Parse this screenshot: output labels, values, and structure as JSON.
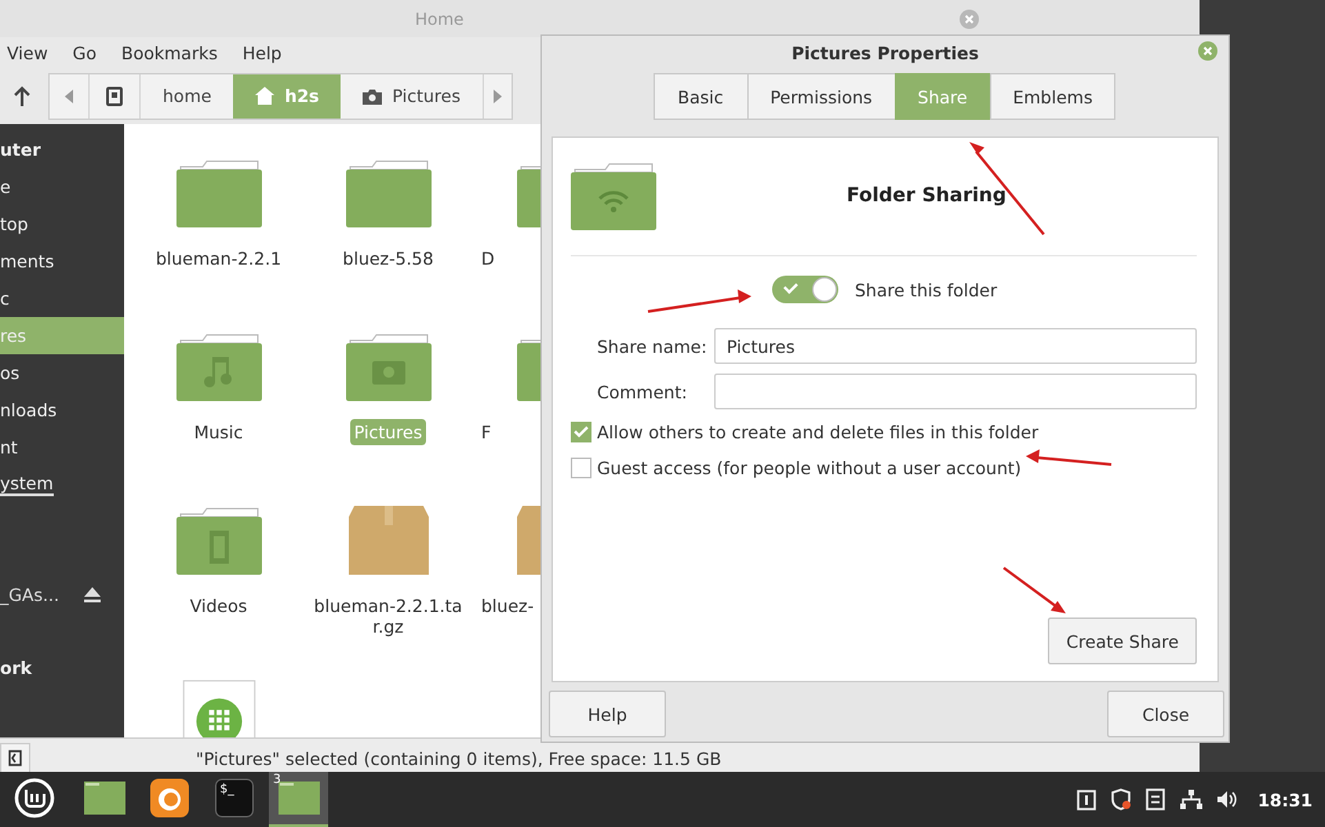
{
  "file_manager": {
    "title": "Home",
    "menu": [
      "View",
      "Go",
      "Bookmarks",
      "Help"
    ],
    "breadcrumbs": [
      {
        "label": "home",
        "selected": false
      },
      {
        "label": "h2s",
        "selected": true
      },
      {
        "label": "Pictures",
        "selected": false
      }
    ],
    "sidebar": [
      {
        "kind": "header",
        "label": "uter",
        "selected": false
      },
      {
        "kind": "place",
        "label": "e",
        "selected": false
      },
      {
        "kind": "place",
        "label": "top",
        "selected": false
      },
      {
        "kind": "place",
        "label": "ments",
        "selected": false
      },
      {
        "kind": "place",
        "label": "c",
        "selected": false
      },
      {
        "kind": "place",
        "label": "res",
        "selected": true
      },
      {
        "kind": "place",
        "label": "os",
        "selected": false
      },
      {
        "kind": "place",
        "label": "nloads",
        "selected": false
      },
      {
        "kind": "place",
        "label": "nt",
        "selected": false
      },
      {
        "kind": "drive",
        "label": "ystem",
        "selected": false
      },
      {
        "kind": "device",
        "label": "_GAs...",
        "selected": false
      },
      {
        "kind": "header",
        "label": "ork",
        "selected": false
      }
    ],
    "files": [
      {
        "name": "blueman-2.2.1",
        "kind": "folder",
        "selected": false
      },
      {
        "name": "bluez-5.58",
        "kind": "folder",
        "selected": false
      },
      {
        "name": "D",
        "kind": "folder",
        "selected": false
      },
      {
        "name": "Music",
        "kind": "music",
        "selected": false
      },
      {
        "name": "Pictures",
        "kind": "pictures",
        "selected": true
      },
      {
        "name": "F",
        "kind": "folder",
        "selected": false
      },
      {
        "name": "Videos",
        "kind": "videos",
        "selected": false
      },
      {
        "name": "blueman-2.2.1.tar.gz",
        "kind": "archive",
        "selected": false
      },
      {
        "name": "bluez-",
        "kind": "archive",
        "selected": false
      },
      {
        "kind": "app"
      }
    ],
    "status": "\"Pictures\" selected (containing 0 items), Free space: 11.5 GB"
  },
  "dialog": {
    "title": "Pictures Properties",
    "tabs": [
      {
        "label": "Basic",
        "selected": false
      },
      {
        "label": "Permissions",
        "selected": false
      },
      {
        "label": "Share",
        "selected": true
      },
      {
        "label": "Emblems",
        "selected": false
      }
    ],
    "heading": "Folder Sharing",
    "share_toggle": {
      "label": "Share this folder",
      "on": true
    },
    "fields": [
      {
        "label": "Share name:",
        "value": "Pictures"
      },
      {
        "label": "Comment:"
      }
    ],
    "checkboxes": [
      {
        "label": "Allow others to create and delete files in this folder",
        "checked": true
      },
      {
        "label": "Guest access (for people without a user account)",
        "checked": false
      }
    ],
    "action_button": "Create Share",
    "buttons": [
      "Help",
      "Close"
    ]
  },
  "taskbar": {
    "apps": [
      {
        "kind": "menu",
        "active": false
      },
      {
        "kind": "files",
        "active": false
      },
      {
        "kind": "browser",
        "active": false
      },
      {
        "kind": "terminal",
        "label": "$_",
        "active": false
      },
      {
        "kind": "files",
        "badge": "3",
        "active": true
      }
    ],
    "clock": "18:31"
  }
}
